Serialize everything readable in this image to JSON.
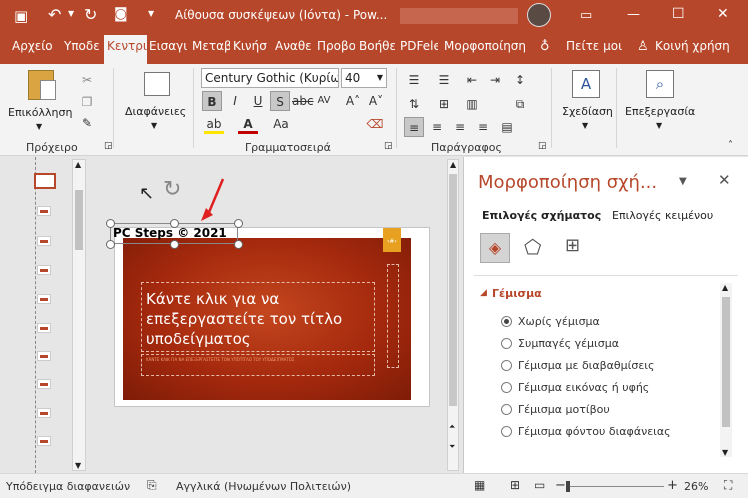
{
  "title_bar": {
    "title": "Αίθουσα συσκέψεων (Ιόντα) - Pow...",
    "minimize": "—",
    "maximize": "☐",
    "close": "✕"
  },
  "tabs": [
    {
      "label": "Αρχείο"
    },
    {
      "label": "Υποδε"
    },
    {
      "label": "Κεντρι"
    },
    {
      "label": "Εισαγι"
    },
    {
      "label": "Μεταβ"
    },
    {
      "label": "Κινήσ"
    },
    {
      "label": "Αναθε"
    },
    {
      "label": "Προβο"
    },
    {
      "label": "Βοήθε"
    },
    {
      "label": "PDFele"
    },
    {
      "label": "Μορφοποίηση"
    },
    {
      "label": "Πείτε μοι"
    },
    {
      "label": "Κοινή χρήση"
    }
  ],
  "ribbon": {
    "paste_label": "Επικόλληση",
    "slides_label": "Διαφάνειες",
    "font_name": "Century Gothic (Κυρίω",
    "font_size": "40",
    "bold": "B",
    "italic": "I",
    "underline": "U",
    "shadow": "S",
    "spacing": "AV",
    "case": "Aa",
    "draw_label": "Σχεδίαση",
    "edit_label": "Επεξεργασία",
    "groups": {
      "clipboard": "Πρόχειρο",
      "font": "Γραμματοσειρά",
      "paragraph": "Παράγραφος"
    }
  },
  "slide": {
    "textbox_text": "PC Steps © 2021",
    "title_placeholder": "Κάντε κλικ για να επεξεργαστείτε τον τίτλο υποδείγματος",
    "subtitle_placeholder": "ΚΆΝΤΕ ΚΛΙΚ ΓΙΑ ΝΑ ΕΠΕΞΕΡΓΑΣΤΕΊΤΕ ΤΟΝ ΥΠΌΤΙΤΛΟ ΤΟΥ ΥΠΟΔΕΊΓΜΑΤΟΣ",
    "accent_color": "#b7472a",
    "slide_color": "#a5290d"
  },
  "format_pane": {
    "title": "Μορφοποίηση σχή...",
    "tab_shape": "Επιλογές σχήματος",
    "tab_text": "Επιλογές κειμένου",
    "section": "Γέμισμα",
    "options": [
      {
        "label": "Χωρίς γέμισμα",
        "selected": true
      },
      {
        "label": "Συμπαγές γέμισμα",
        "selected": false
      },
      {
        "label": "Γέμισμα με διαβαθμίσεις",
        "selected": false
      },
      {
        "label": "Γέμισμα εικόνας ή υφής",
        "selected": false
      },
      {
        "label": "Γέμισμα μοτίβου",
        "selected": false
      },
      {
        "label": "Γέμισμα φόντου διαφάνειας",
        "selected": false
      }
    ]
  },
  "status_bar": {
    "view": "Υπόδειγμα διαφανειών",
    "language": "Αγγλικά (Ηνωμένων Πολιτειών)",
    "zoom": "26%",
    "zoom_minus": "−",
    "zoom_plus": "+"
  }
}
